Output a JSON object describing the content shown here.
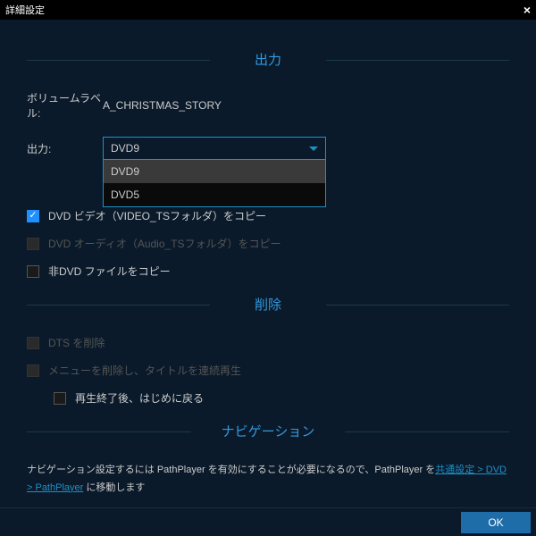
{
  "window": {
    "title": "詳細設定"
  },
  "output": {
    "header": "出力",
    "volume_label_text": "ボリュームラベル:",
    "volume_label_value": "A_CHRISTMAS_STORY",
    "dest_label": "出力:",
    "dest_selected": "DVD9",
    "dest_options": [
      "DVD9",
      "DVD5"
    ],
    "cb_video": "DVD ビデオ（VIDEO_TSフォルダ）をコピー",
    "cb_audio": "DVD オーディオ（Audio_TSフォルダ）をコピー",
    "cb_nondvd": "非DVD ファイルをコピー"
  },
  "remove": {
    "header": "削除",
    "cb_dts": "DTS を削除",
    "cb_menu": "メニューを削除し、タイトルを連続再生",
    "cb_loop": "再生終了後、はじめに戻る"
  },
  "nav": {
    "header": "ナビゲーション",
    "text1": "ナビゲーション設定するには PathPlayer を有効にすることが必要になるので、PathPlayer を",
    "link": "共通設定 > DVD > PathPlayer",
    "text2": " に移動します"
  },
  "footer": {
    "ok": "OK"
  }
}
